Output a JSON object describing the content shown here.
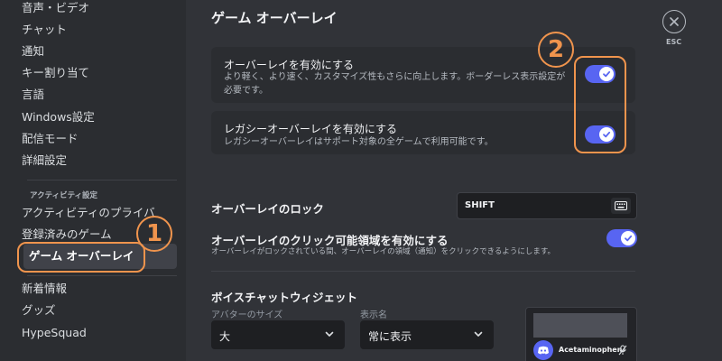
{
  "sidebar": {
    "items": [
      {
        "label": "音声・ビデオ"
      },
      {
        "label": "チャット"
      },
      {
        "label": "通知"
      },
      {
        "label": "キー割り当て"
      },
      {
        "label": "言語"
      },
      {
        "label": "Windows設定"
      },
      {
        "label": "配信モード"
      },
      {
        "label": "詳細設定"
      }
    ],
    "activity_header": "アクティビティ設定",
    "activity_items": [
      {
        "label": "アクティビティのプライバ"
      },
      {
        "label": "登録済みのゲーム"
      },
      {
        "label": "ゲーム オーバーレイ"
      }
    ],
    "misc_items": [
      {
        "label": "新着情報"
      },
      {
        "label": "グッズ"
      },
      {
        "label": "HypeSquad"
      }
    ]
  },
  "page": {
    "title": "ゲーム オーバーレイ",
    "close_label": "ESC"
  },
  "overlay_enable": {
    "title": "オーバーレイを有効にする",
    "description": "より軽く、より速く、カスタマイズ性もさらに向上します。ボーダーレス表示設定が必要です。",
    "enabled": true
  },
  "legacy_overlay": {
    "title": "レガシーオーバーレイを有効にする",
    "description": "レガシーオーバーレイはサポート対象の全ゲームで利用可能です。",
    "enabled": true
  },
  "overlay_lock": {
    "title": "オーバーレイのロック",
    "key": "SHIFT"
  },
  "clickable_area": {
    "title": "オーバーレイのクリック可能領域を有効にする",
    "description": "オーバーレイがロックされている間、オーバーレイの領域（通知）をクリックできるようにします。",
    "enabled": true
  },
  "voice_widget": {
    "title": "ボイスチャットウィジェット",
    "avatar_size_label": "アバターのサイズ",
    "avatar_size_value": "大",
    "display_name_label": "表示名",
    "display_name_value": "常に表示",
    "preview_username": "Acetaminophen"
  },
  "annotations": {
    "one": "1",
    "two": "2"
  },
  "colors": {
    "accent": "#5865f2",
    "annotation": "#f0944d",
    "background": "#313338",
    "sidebar": "#2b2d31"
  }
}
